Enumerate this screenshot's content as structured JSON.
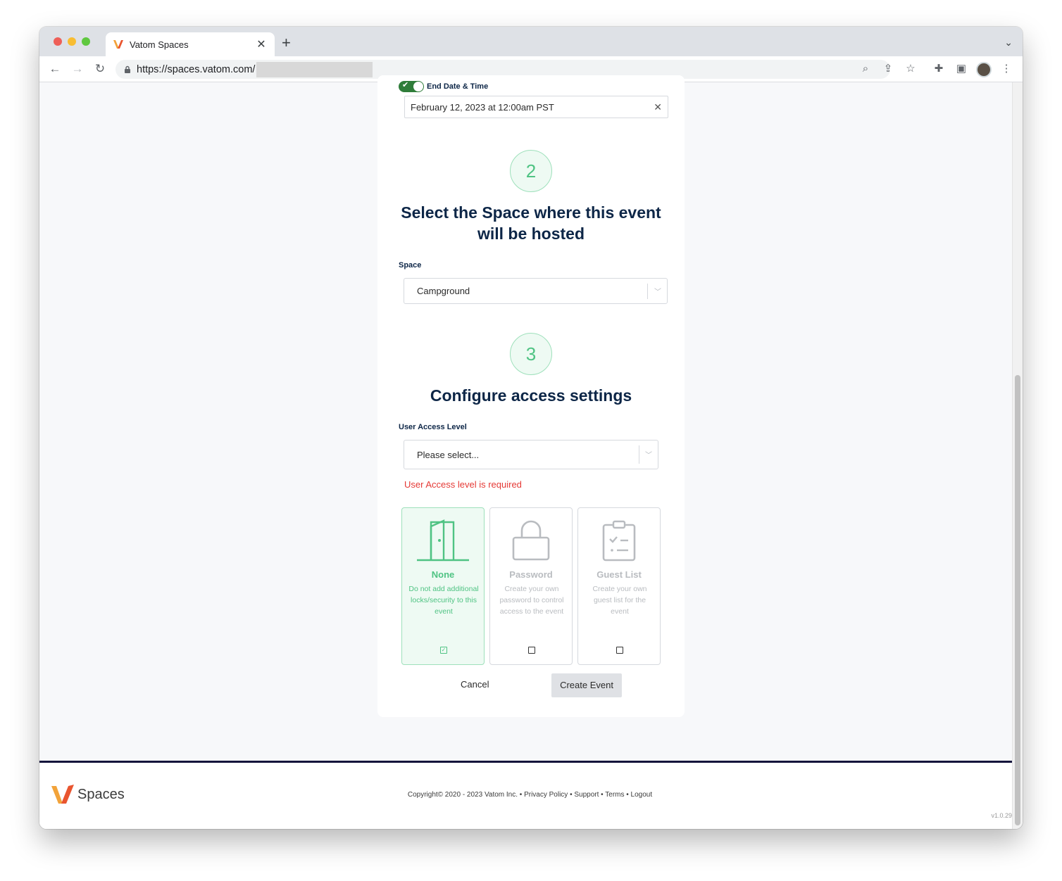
{
  "browser": {
    "tab_title": "Vatom Spaces",
    "url": "https://spaces.vatom.com/"
  },
  "form": {
    "end_date_label": "End Date & Time",
    "end_date_value": "February 12, 2023 at 12:00am PST",
    "step2_number": "2",
    "step2_heading_line1": "Select the Space where this event",
    "step2_heading_line2": "will be hosted",
    "space_label": "Space",
    "space_value": "Campground",
    "step3_number": "3",
    "step3_heading": "Configure access settings",
    "access_label": "User Access Level",
    "access_placeholder": "Please select...",
    "access_error": "User Access level is required",
    "options": [
      {
        "title": "None",
        "desc": "Do not add additional locks/security to this event",
        "checked": true
      },
      {
        "title": "Password",
        "desc": "Create your own password to control access to the event",
        "checked": false
      },
      {
        "title": "Guest List",
        "desc": "Create your own guest list for the event",
        "checked": false
      }
    ],
    "cancel_label": "Cancel",
    "create_label": "Create Event"
  },
  "footer": {
    "brand": "Spaces",
    "links": "Copyright© 2020 - 2023 Vatom Inc. • Privacy Policy • Support • Terms • Logout",
    "version": "v1.0.29"
  },
  "colors": {
    "accent_green": "#4fc383",
    "heading_navy": "#0d2647",
    "error_red": "#e53935"
  }
}
